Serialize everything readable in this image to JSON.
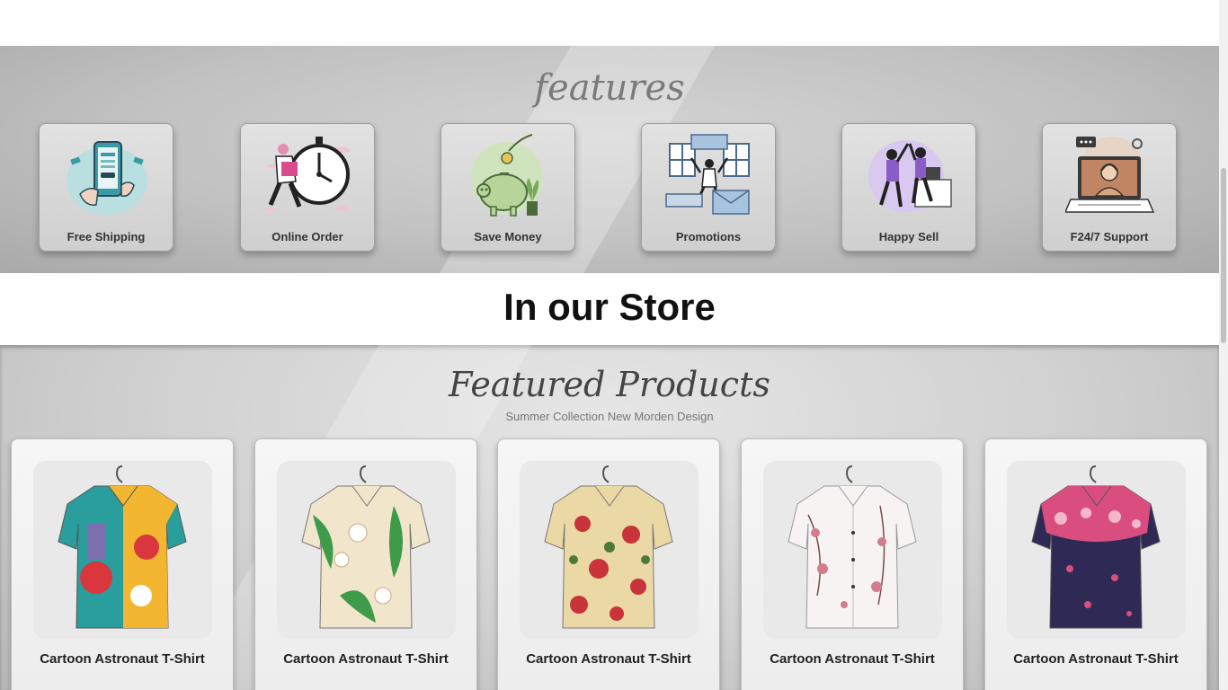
{
  "features": {
    "title": "features",
    "items": [
      {
        "label": "Free Shipping",
        "icon": "phone-payment-icon"
      },
      {
        "label": "Online Order",
        "icon": "clock-delivery-icon"
      },
      {
        "label": "Save Money",
        "icon": "piggy-bank-icon"
      },
      {
        "label": "Promotions",
        "icon": "shop-promotion-icon"
      },
      {
        "label": "Happy Sell",
        "icon": "high-five-icon"
      },
      {
        "label": "F24/7 Support",
        "icon": "laptop-support-icon"
      }
    ]
  },
  "store": {
    "heading": "In our Store"
  },
  "products": {
    "title": "Featured Products",
    "subtitle": "Summer Collection New Morden Design",
    "items": [
      {
        "name": "Cartoon Astronaut T-Shirt",
        "colors": [
          "#f2b630",
          "#2a9d9d",
          "#d9363e"
        ]
      },
      {
        "name": "Cartoon Astronaut T-Shirt",
        "colors": [
          "#f1e5cc",
          "#3d9b4a",
          "#ffffff"
        ]
      },
      {
        "name": "Cartoon Astronaut T-Shirt",
        "colors": [
          "#ead8a5",
          "#c8343a",
          "#4c7a3a"
        ]
      },
      {
        "name": "Cartoon Astronaut T-Shirt",
        "colors": [
          "#f7f3f3",
          "#d47b8c",
          "#7a4a4a"
        ]
      },
      {
        "name": "Cartoon Astronaut T-Shirt",
        "colors": [
          "#2e2a55",
          "#d94e7e",
          "#f4b6c8"
        ]
      }
    ]
  }
}
